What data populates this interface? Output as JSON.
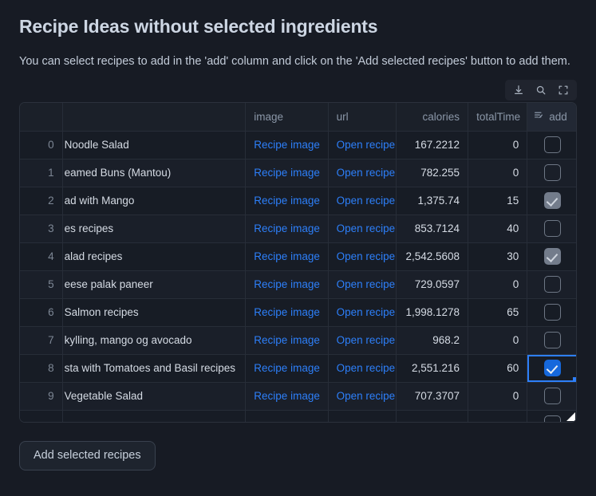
{
  "header": {
    "title": "Recipe Ideas without selected ingredients",
    "description": "You can select recipes to add in the 'add' column and click on the 'Add selected recipes' button to add them."
  },
  "toolbar": {
    "download_label": "download-icon",
    "search_label": "search-icon",
    "fullscreen_label": "fullscreen-icon"
  },
  "table": {
    "columns": [
      {
        "key": "index",
        "label": ""
      },
      {
        "key": "name",
        "label": ""
      },
      {
        "key": "image",
        "label": "image"
      },
      {
        "key": "url",
        "label": "url"
      },
      {
        "key": "calories",
        "label": "calories"
      },
      {
        "key": "totalTime",
        "label": "totalTime"
      },
      {
        "key": "add",
        "label": "add"
      }
    ],
    "image_link_text": "Recipe image",
    "url_link_text": "Open recipe",
    "rows": [
      {
        "index": "0",
        "name": "Noodle Salad",
        "image": "Recipe image",
        "url": "Open recipe",
        "calories": "167.2212",
        "totalTime": "0",
        "add": "unchecked"
      },
      {
        "index": "1",
        "name": "eamed Buns (Mantou)",
        "image": "Recipe image",
        "url": "Open recipe",
        "calories": "782.255",
        "totalTime": "0",
        "add": "unchecked"
      },
      {
        "index": "2",
        "name": "ad with Mango",
        "image": "Recipe image",
        "url": "Open recipe",
        "calories": "1,375.74",
        "totalTime": "15",
        "add": "checked-grey"
      },
      {
        "index": "3",
        "name": "es recipes",
        "image": "Recipe image",
        "url": "Open recipe",
        "calories": "853.7124",
        "totalTime": "40",
        "add": "unchecked"
      },
      {
        "index": "4",
        "name": "alad recipes",
        "image": "Recipe image",
        "url": "Open recipe",
        "calories": "2,542.5608",
        "totalTime": "30",
        "add": "checked-grey"
      },
      {
        "index": "5",
        "name": "eese palak paneer",
        "image": "Recipe image",
        "url": "Open recipe",
        "calories": "729.0597",
        "totalTime": "0",
        "add": "unchecked"
      },
      {
        "index": "6",
        "name": "Salmon recipes",
        "image": "Recipe image",
        "url": "Open recipe",
        "calories": "1,998.1278",
        "totalTime": "65",
        "add": "unchecked"
      },
      {
        "index": "7",
        "name": "kylling, mango og avocado",
        "image": "Recipe image",
        "url": "Open recipe",
        "calories": "968.2",
        "totalTime": "0",
        "add": "unchecked"
      },
      {
        "index": "8",
        "name": "sta with Tomatoes and Basil recipes",
        "image": "Recipe image",
        "url": "Open recipe",
        "calories": "2,551.216",
        "totalTime": "60",
        "add": "checked-blue-selected"
      },
      {
        "index": "9",
        "name": "Vegetable Salad",
        "image": "Recipe image",
        "url": "Open recipe",
        "calories": "707.3707",
        "totalTime": "0",
        "add": "unchecked"
      },
      {
        "index": "",
        "name": "",
        "image": "",
        "url": "",
        "calories": "",
        "totalTime": "",
        "add": "unchecked"
      }
    ]
  },
  "footer": {
    "add_button_label": "Add selected recipes"
  },
  "colors": {
    "page_bg": "#171b24",
    "grid_bg": "#161b22",
    "link": "#2d7ff9",
    "accent": "#1668dc",
    "border": "#2b313c"
  }
}
